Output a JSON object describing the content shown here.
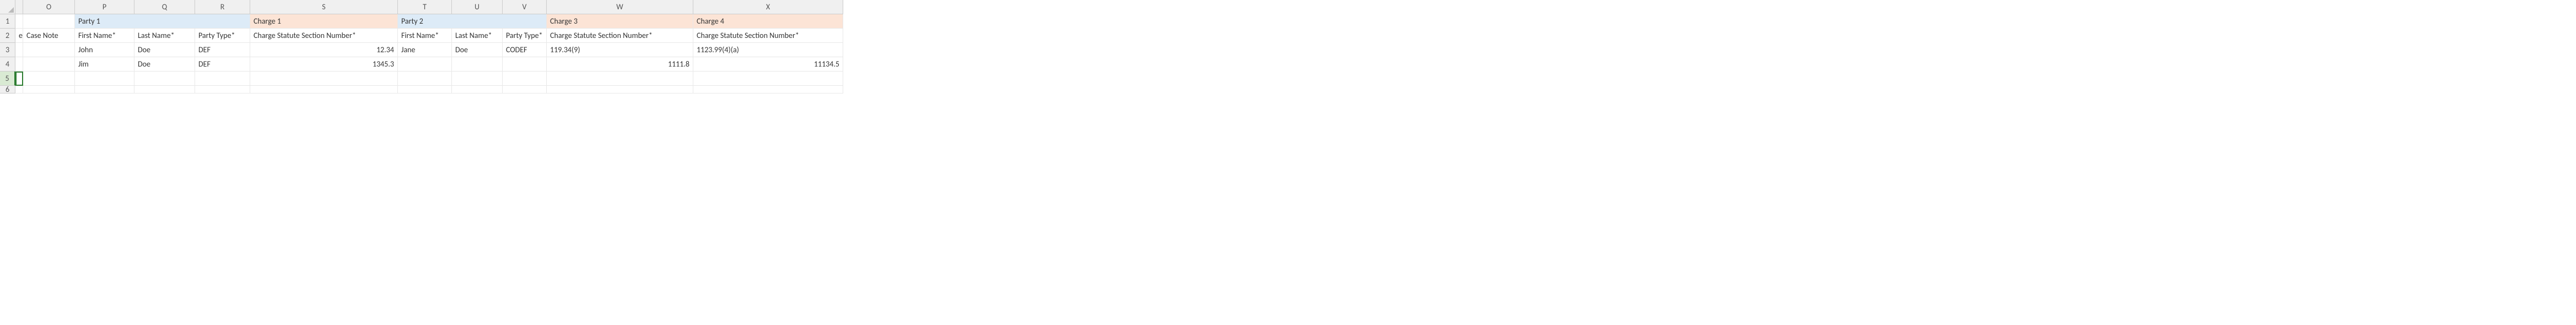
{
  "columns": [
    "O",
    "P",
    "Q",
    "R",
    "S",
    "T",
    "U",
    "V",
    "W",
    "X"
  ],
  "row_numbers": [
    "1",
    "2",
    "3",
    "4",
    "5",
    "6"
  ],
  "partial_cell_text": "e",
  "group_headers": {
    "party1": "Party 1",
    "charge1": "Charge 1",
    "party2": "Party 2",
    "charge3": "Charge 3",
    "charge4": "Charge 4"
  },
  "headers": {
    "case_note": "Case Note",
    "p1_first": "First Name*",
    "p1_last": "Last Name*",
    "p1_type": "Party Type*",
    "c1_statute": "Charge Statute Section Number*",
    "p2_first": "First Name*",
    "p2_last": "Last Name*",
    "p2_type": "Party Type*",
    "c3_statute": "Charge Statute Section Number*",
    "c4_statute": "Charge Statute Section Number*"
  },
  "rows": [
    {
      "p1_first": "John",
      "p1_last": "Doe",
      "p1_type": "DEF",
      "c1_statute": "12.34",
      "p2_first": "Jane",
      "p2_last": "Doe",
      "p2_type": "CODEF",
      "c3_statute": "119.34(9)",
      "c4_statute": "1123.99(4)(a)"
    },
    {
      "p1_first": "Jim",
      "p1_last": "Doe",
      "p1_type": "DEF",
      "c1_statute": "1345.3",
      "p2_first": "",
      "p2_last": "",
      "p2_type": "",
      "c3_statute": "1111.8",
      "c4_statute": "11134.5"
    }
  ],
  "chart_data": {
    "type": "table",
    "columns": [
      "Case Note",
      "First Name*",
      "Last Name*",
      "Party Type*",
      "Charge Statute Section Number*",
      "First Name*",
      "Last Name*",
      "Party Type*",
      "Charge Statute Section Number*",
      "Charge Statute Section Number*"
    ],
    "group_spans": [
      {
        "label": "Party 1",
        "cols": [
          "P",
          "Q",
          "R"
        ]
      },
      {
        "label": "Charge 1",
        "cols": [
          "S"
        ]
      },
      {
        "label": "Party 2",
        "cols": [
          "T",
          "U",
          "V"
        ]
      },
      {
        "label": "Charge 3",
        "cols": [
          "W"
        ]
      },
      {
        "label": "Charge 4",
        "cols": [
          "X"
        ]
      }
    ],
    "data": [
      [
        "",
        "John",
        "Doe",
        "DEF",
        "12.34",
        "Jane",
        "Doe",
        "CODEF",
        "119.34(9)",
        "1123.99(4)(a)"
      ],
      [
        "",
        "Jim",
        "Doe",
        "DEF",
        "1345.3",
        "",
        "",
        "",
        "1111.8",
        "11134.5"
      ]
    ]
  }
}
